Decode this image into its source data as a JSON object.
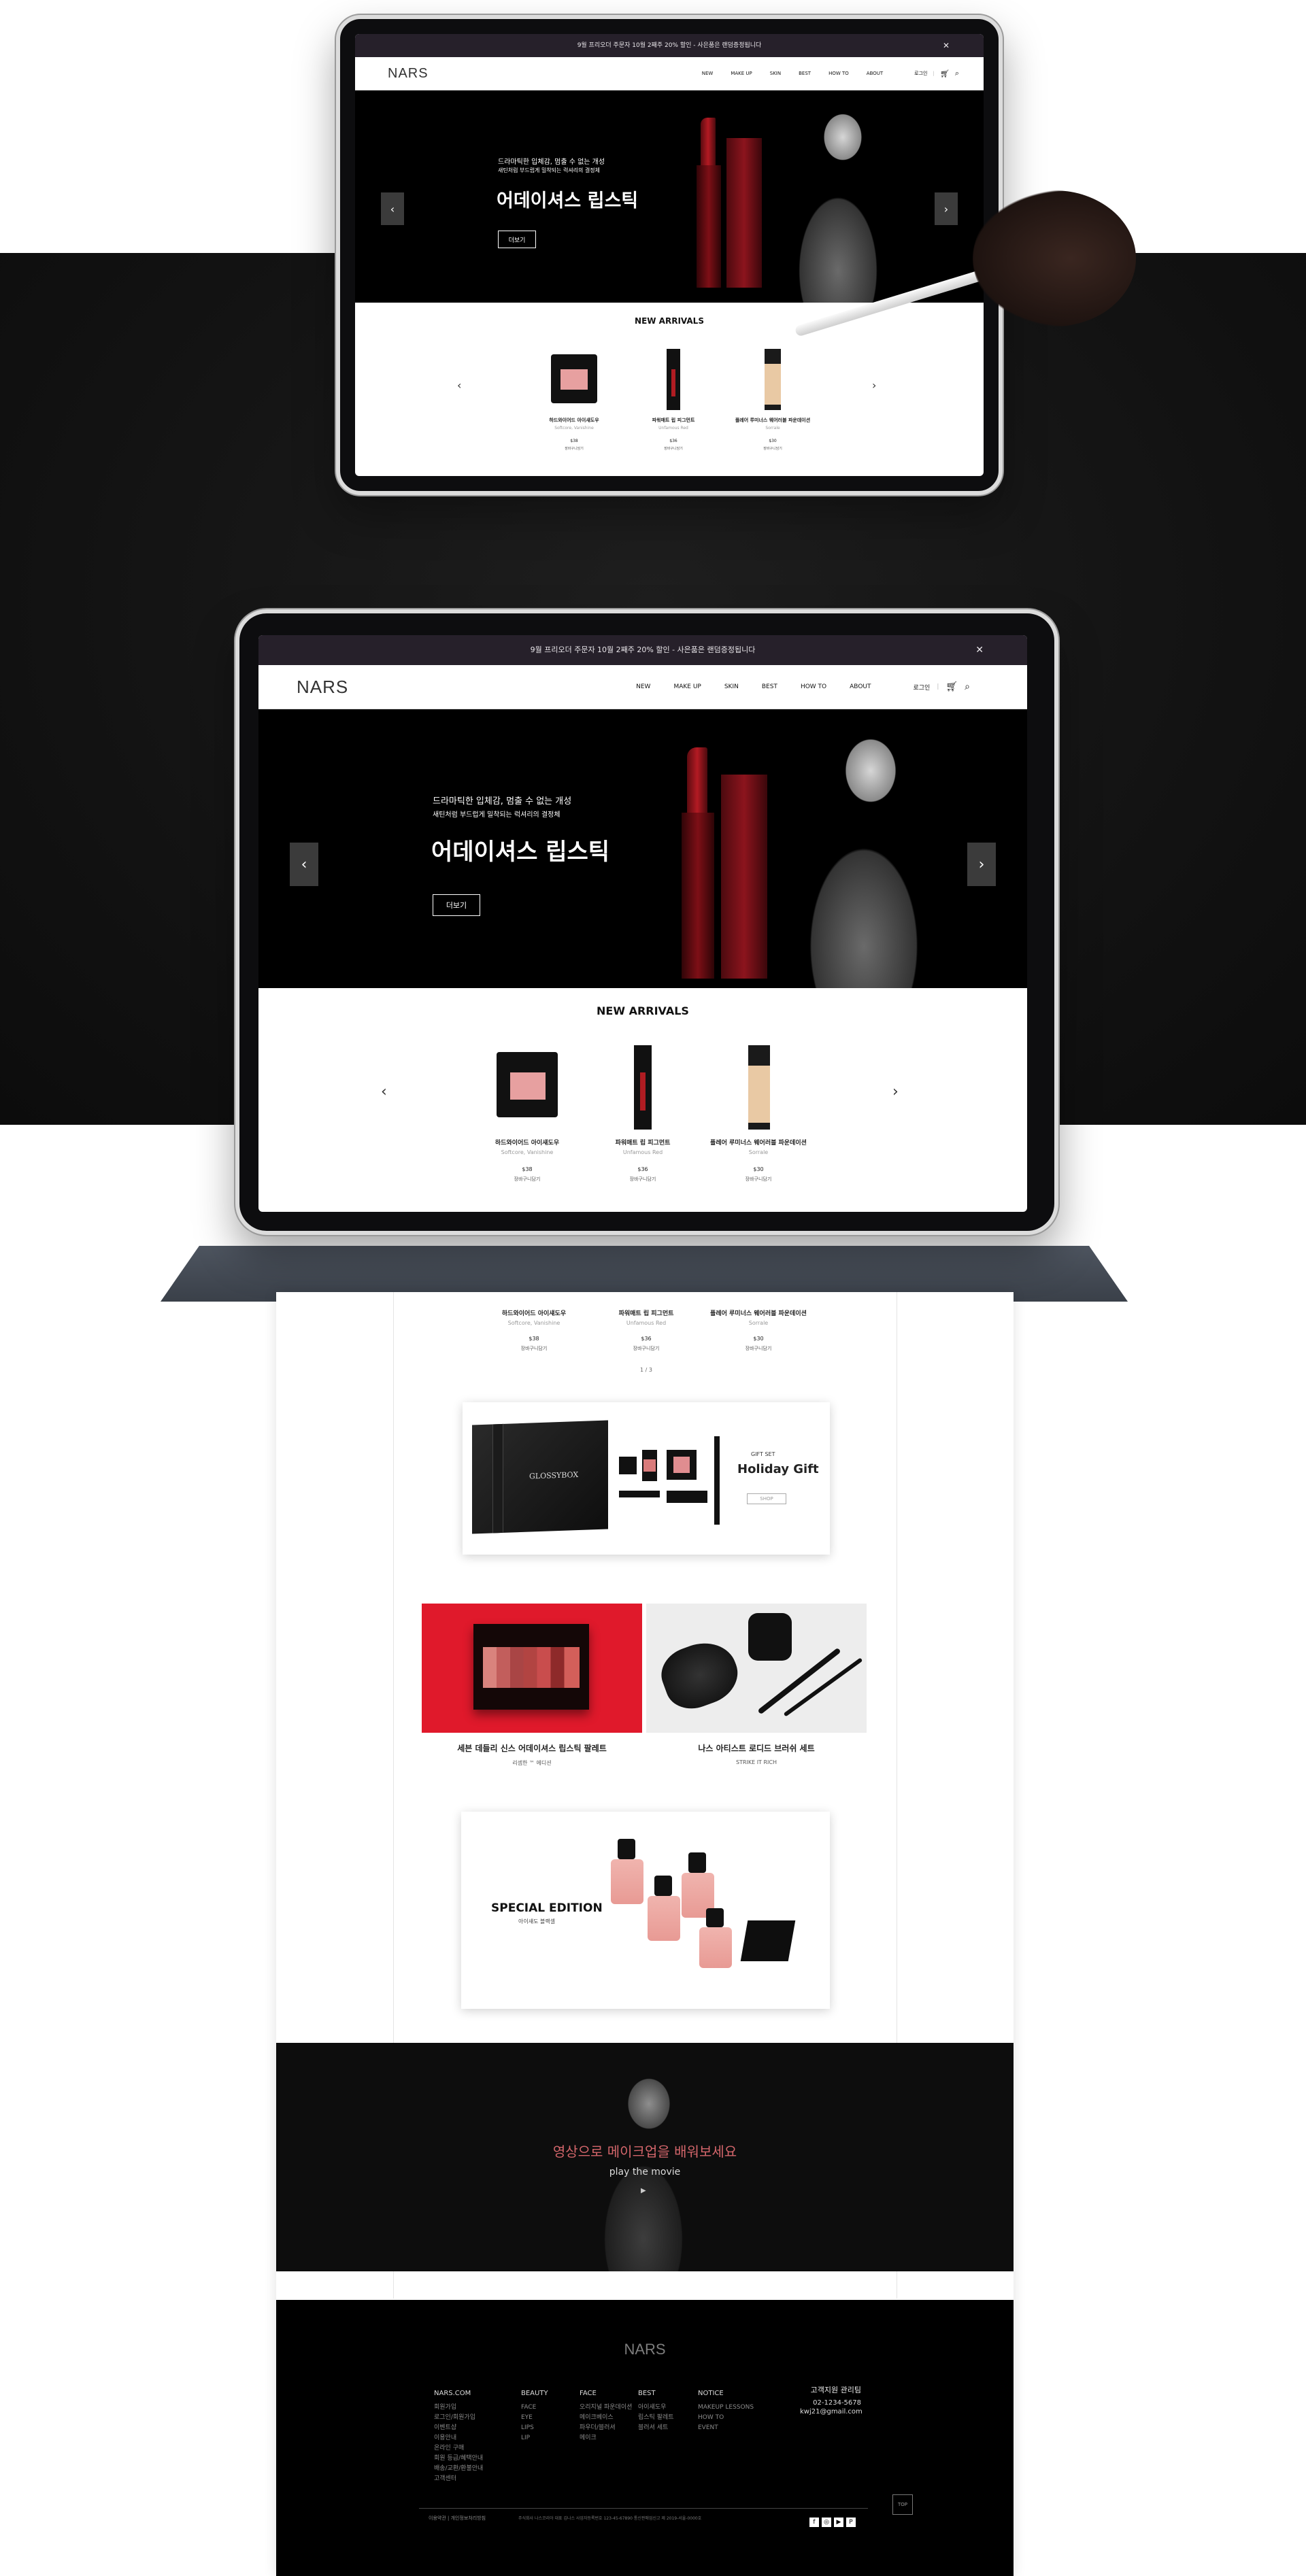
{
  "site": {
    "notice": "9월 프리오더 주문자 10월 2째주 20% 할인 - 사은품은 랜덤증정됩니다",
    "close_icon": "close-icon",
    "logo": "NARS",
    "menu": [
      "NEW",
      "MAKE UP",
      "SKIN",
      "BEST",
      "HOW TO",
      "ABOUT"
    ],
    "login": "로그인",
    "cart_icon": "cart-icon",
    "search_icon": "search-icon",
    "hero": {
      "sub1": "드라마틱한 입체감, 멈출 수 없는 개성",
      "sub2": "새틴처럼 부드럽게 밀착되는 럭셔리의 결정체",
      "title": "어데이셔스 립스틱",
      "button": "더보기",
      "prev_icon": "chevron-left-icon",
      "next_icon": "chevron-right-icon"
    },
    "new_arrivals": {
      "title": "NEW ARRIVALS",
      "products": [
        {
          "name": "하드와이어드 아이섀도우",
          "en": "Softcore, Vanishine",
          "price": "$38",
          "cart": "장바구니담기"
        },
        {
          "name": "파워매트 립 피그먼트",
          "en": "Unfamous Red",
          "price": "$36",
          "cart": "장바구니담기"
        },
        {
          "name": "플레어 루미너스 웨어러블 파운데이션",
          "en": "Sorrale",
          "price": "$30",
          "cart": "장바구니담기"
        }
      ],
      "pager": "1 / 3"
    },
    "gift": {
      "small": "GIFT SET",
      "title": "Holiday Gift",
      "button": "SHOP",
      "box_label": "GLOSSYBOX"
    },
    "promos": [
      {
        "title": "세븐 데들리 신스 어데이셔스 립스틱 팔레트",
        "sub": "리셉한 ™ 에디션"
      },
      {
        "title": "나스 아티스트 로디드 브러쉬 세트",
        "sub": "STRIKE IT RICH"
      }
    ],
    "special": {
      "title": "SPECIAL EDITION",
      "sub": "아이섀도 블랙셀"
    },
    "movie": {
      "title": "영상으로 메이크업을 배워보세요",
      "sub": "play the movie"
    },
    "footer": {
      "logo": "NARS",
      "columns": [
        {
          "head": "NARS.COM",
          "items": [
            "회원가입",
            "로그인/회원가입",
            "이벤트샵",
            "이용안내",
            "온라인 구매",
            "회원 등급/혜택안내",
            "배송/교환/환불안내",
            "고객센터"
          ]
        },
        {
          "head": "BEAUTY",
          "items": [
            "FACE",
            "EYE",
            "LIPS",
            "LIP"
          ]
        },
        {
          "head": "FACE",
          "items": [
            "오리지널 파운데이션",
            "메이크베이스",
            "파우더/블러셔",
            "메이크"
          ]
        },
        {
          "head": "BEST",
          "items": [
            "아이섀도우",
            "립스틱 팔레트",
            "블러셔 세트"
          ]
        },
        {
          "head": "NOTICE",
          "items": [
            "MAKEUP LESSONS",
            "HOW TO",
            "EVENT"
          ]
        }
      ],
      "cs_title": "고객지원 관리팀",
      "cs_phone": "02-1234-5678",
      "cs_email": "kwj21@gmail.com",
      "copy1": "이용약관 | 개인정보처리방침",
      "copy2": "주식회사 나스코리아 대표 김나스 사업자등록번호 123-45-67890 통신판매업신고 제 2019-서울-0000호",
      "top_label": "TOP",
      "sns_icons": [
        "facebook-icon",
        "instagram-icon",
        "youtube-icon",
        "pinterest-icon"
      ]
    }
  },
  "colors": {
    "notice_bar": "#26202a",
    "accent_red": "#e33b4a",
    "movie_title": "#d4666b"
  }
}
